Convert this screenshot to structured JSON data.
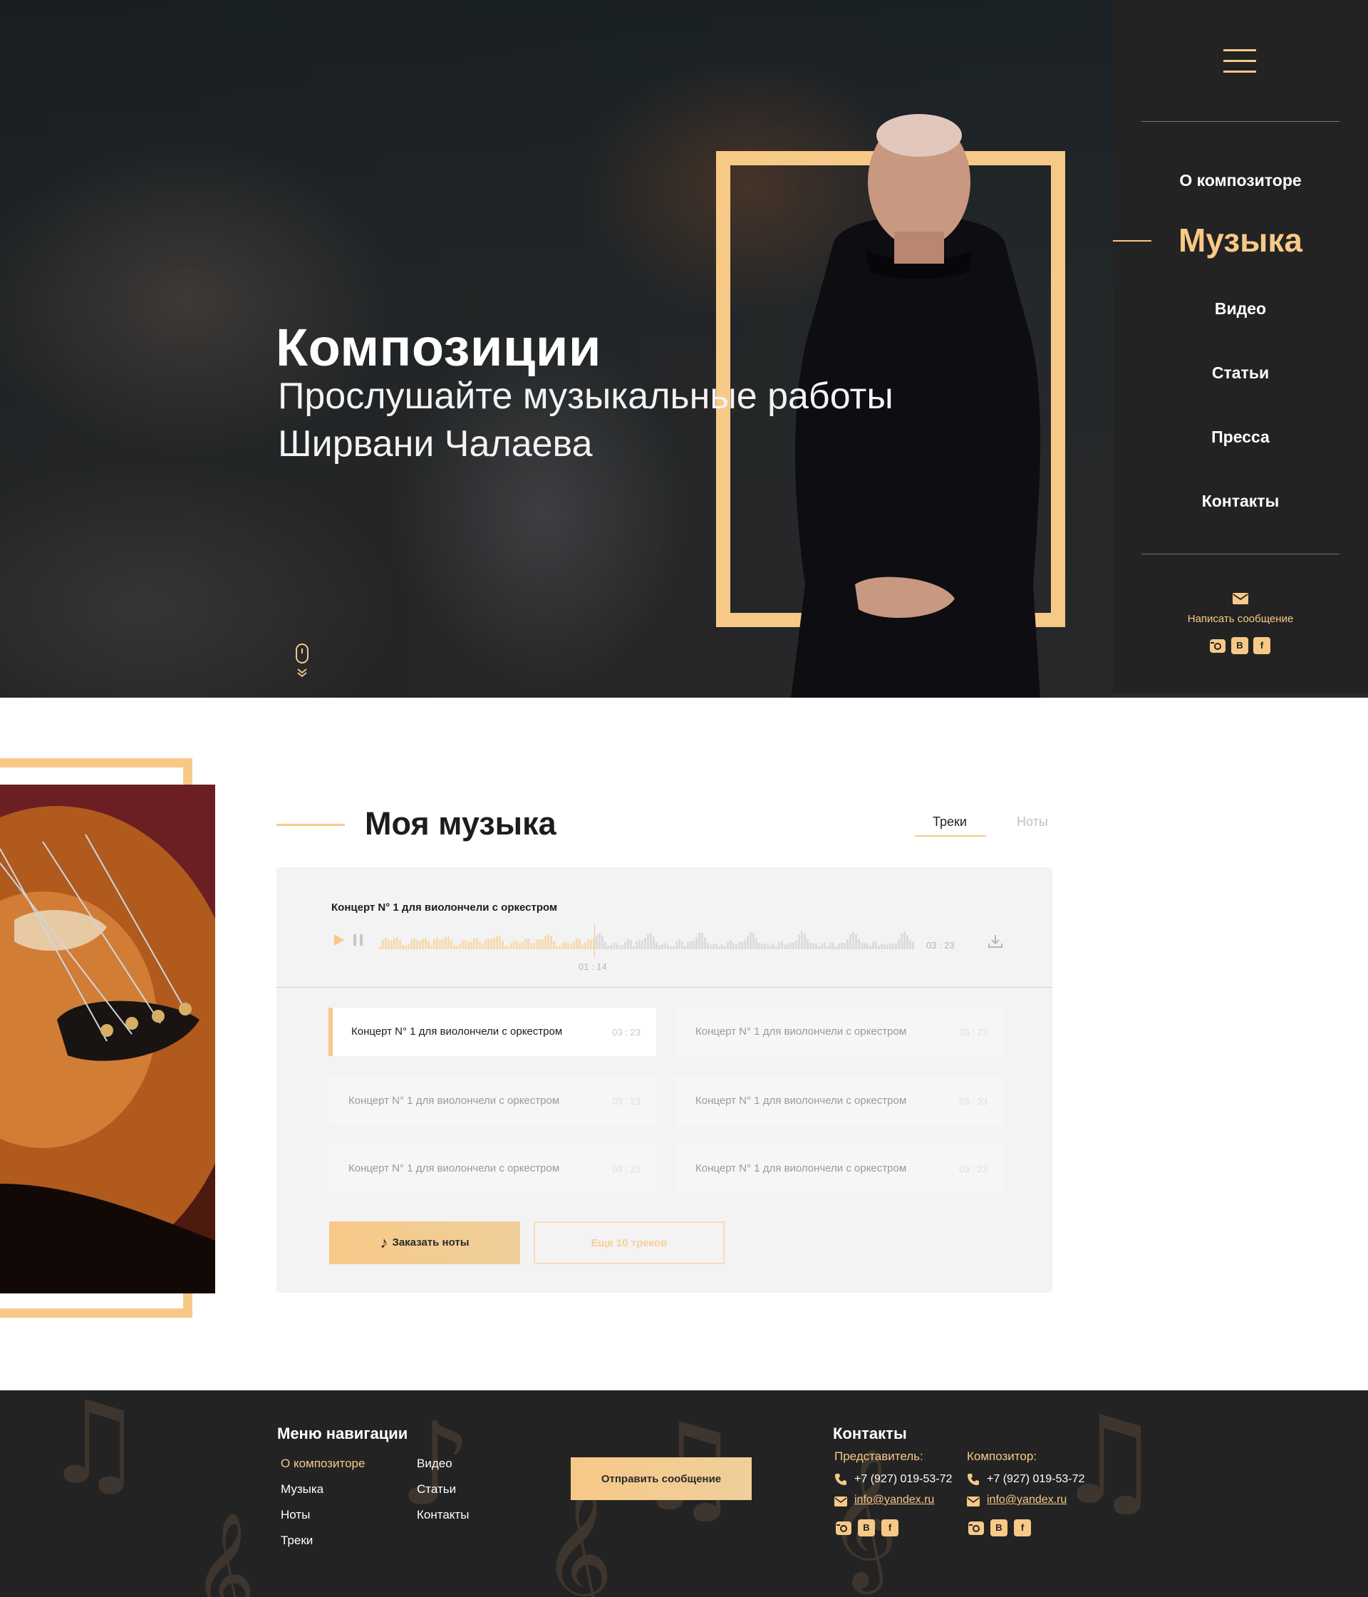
{
  "hero": {
    "title": "Композиции",
    "subtitle": "Прослушайте музыкальные работы Ширвани Чалаева"
  },
  "sidebar": {
    "nav": [
      {
        "label": "О композиторе",
        "active": false
      },
      {
        "label": "Музыка",
        "active": true
      },
      {
        "label": "Видео",
        "active": false
      },
      {
        "label": "Статьи",
        "active": false
      },
      {
        "label": "Пресса",
        "active": false
      },
      {
        "label": "Контакты",
        "active": false
      }
    ],
    "write_label": "Написать сообщение",
    "social": {
      "vk": "В",
      "fb": "f"
    }
  },
  "music": {
    "title": "Моя музыка",
    "tabs": [
      {
        "label": "Треки",
        "active": true
      },
      {
        "label": "Ноты",
        "active": false
      }
    ],
    "player": {
      "track_title": "Концерт N° 1 для виолончели с оркестром",
      "current_time": "01 : 14",
      "total_time": "03 : 23",
      "progress": 0.4
    },
    "tracks": [
      {
        "title": "Концерт N° 1 для виолончели с оркестром",
        "duration": "03 : 23"
      },
      {
        "title": "Концерт N° 1 для виолончели с оркестром",
        "duration": "03 : 23"
      },
      {
        "title": "Концерт N° 1 для виолончели с оркестром",
        "duration": "03 : 23"
      },
      {
        "title": "Концерт N° 1 для виолончели с оркестром",
        "duration": "03 : 23"
      },
      {
        "title": "Концерт N° 1 для виолончели с оркестром",
        "duration": "03 : 23"
      },
      {
        "title": "Концерт N° 1 для виолончели с оркестром",
        "duration": "03 : 23"
      }
    ],
    "order_label": "Заказать ноты",
    "more_label": "Еще 10 треков"
  },
  "footer": {
    "menu_title": "Меню навигации",
    "menu_col1": [
      "О композиторе",
      "Музыка",
      "Ноты",
      "Треки"
    ],
    "menu_col2": [
      "Видео",
      "Статьи",
      "Контакты"
    ],
    "send_label": "Отправить сообщение",
    "contacts_title": "Контакты",
    "rep_label": "Представитель:",
    "rep_phone": "+7 (927) 019-53-72",
    "rep_email": "info@yandex.ru",
    "comp_label": "Композитор:",
    "comp_phone": "+7 (927) 019-53-72",
    "comp_email": "info@yandex.ru"
  },
  "colors": {
    "accent": "#f7c987",
    "dark": "#232323"
  }
}
